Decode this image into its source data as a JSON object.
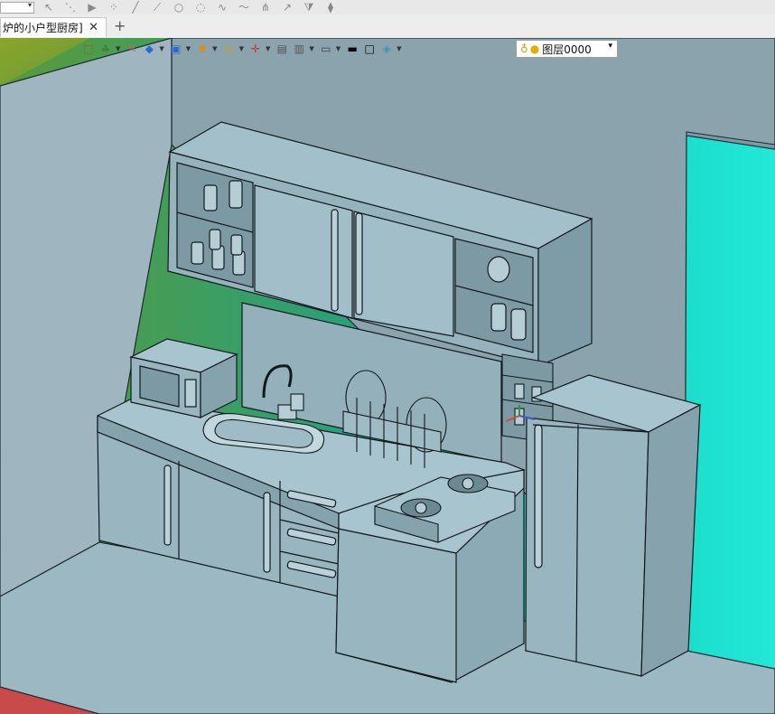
{
  "tab": {
    "title": "炉的小户型厨房]",
    "close": "✕",
    "add": "+"
  },
  "toolbar": {
    "items": [
      {
        "icon": "select-arrow-icon"
      },
      {
        "icon": "sketch-tool-icon"
      },
      {
        "icon": "measure-icon"
      },
      {
        "icon": "solid-box-icon"
      },
      {
        "icon": "render-mode-icon"
      },
      {
        "icon": "fill-color-icon"
      },
      {
        "icon": "material-icon"
      },
      {
        "icon": "origin-axis-icon"
      },
      {
        "icon": "view-icon"
      },
      {
        "icon": "display-icon"
      },
      {
        "icon": "line-color-icon"
      },
      {
        "icon": "face-color-icon"
      },
      {
        "icon": "layer-icon"
      }
    ]
  },
  "layer": {
    "name": "图层0000"
  },
  "colors": {
    "wall": "#8aa4ae",
    "cabinet": "#9ab7c2",
    "floor": "#a0bcc6"
  }
}
